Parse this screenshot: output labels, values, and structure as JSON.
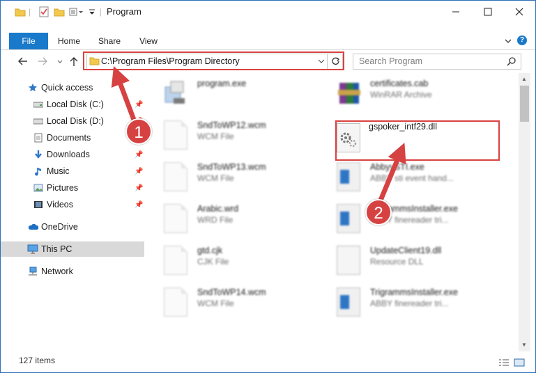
{
  "window": {
    "title": "Program"
  },
  "ribbon": {
    "tabs": [
      "File",
      "Home",
      "Share",
      "View"
    ]
  },
  "address": {
    "path": "C:\\Program Files\\Program Directory"
  },
  "search": {
    "placeholder": "Search Program"
  },
  "nav": {
    "items": [
      {
        "label": "Quick access",
        "icon": "star-icon"
      },
      {
        "label": "Local Disk (C:)",
        "icon": "drive-icon",
        "pinned": true
      },
      {
        "label": "Local Disk (D:)",
        "icon": "drive-icon",
        "pinned": true
      },
      {
        "label": "Documents",
        "icon": "documents-icon",
        "pinned": true
      },
      {
        "label": "Downloads",
        "icon": "downloads-icon",
        "pinned": true
      },
      {
        "label": "Music",
        "icon": "music-icon",
        "pinned": true
      },
      {
        "label": "Pictures",
        "icon": "pictures-icon",
        "pinned": true
      },
      {
        "label": "Videos",
        "icon": "videos-icon",
        "pinned": true
      },
      {
        "label": "OneDrive",
        "icon": "cloud-icon"
      },
      {
        "label": "This PC",
        "icon": "computer-icon",
        "selected": true
      },
      {
        "label": "Network",
        "icon": "network-icon"
      }
    ]
  },
  "files": {
    "left": [
      {
        "name": "program.exe",
        "type": "",
        "icon": "exe-icon"
      },
      {
        "name": "SndToWP12.wcm",
        "type": "WCM File",
        "icon": "document-icon"
      },
      {
        "name": "SndToWP13.wcm",
        "type": "WCM File",
        "icon": "document-icon"
      },
      {
        "name": "Arabic.wrd",
        "type": "WRD File",
        "icon": "document-icon"
      },
      {
        "name": "gtd.cjk",
        "type": "CJK File",
        "icon": "document-icon"
      },
      {
        "name": "SndToWP14.wcm",
        "type": "WCM File",
        "icon": "document-icon"
      }
    ],
    "right": [
      {
        "name": "certificates.cab",
        "type": "WinRAR Archive",
        "icon": "archive-icon"
      },
      {
        "name": "gspoker_intf29.dll",
        "type": "",
        "icon": "dll-icon",
        "highlighted": true
      },
      {
        "name": "AbbyySTI.exe",
        "type": "ABBY sti event hand...",
        "icon": "exe-icon"
      },
      {
        "name": "TrigrammsInstaller.exe",
        "type": "ABBY finereader tri...",
        "icon": "exe-icon"
      },
      {
        "name": "UpdateClient19.dll",
        "type": "Resource DLL",
        "icon": "dll-icon"
      },
      {
        "name": "TrigrammsInstaller.exe",
        "type": "ABBY finereader tri...",
        "icon": "exe-icon"
      }
    ]
  },
  "status": {
    "items_count": "127 items"
  },
  "annotations": {
    "step1": "1",
    "step2": "2",
    "color": "#d64242"
  }
}
